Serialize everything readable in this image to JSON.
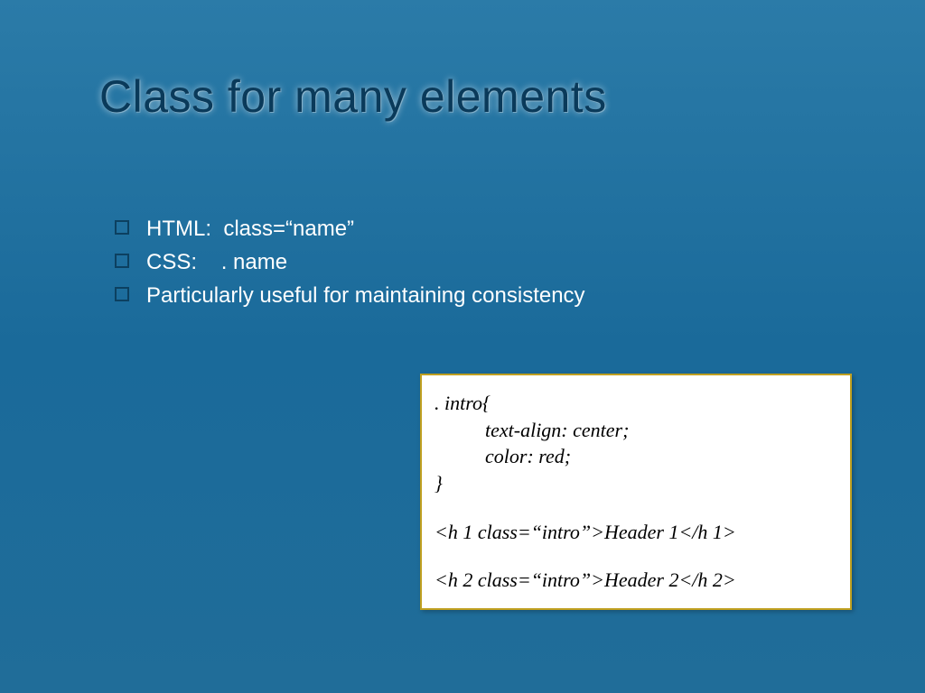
{
  "title": "Class for many elements",
  "bullets": [
    "HTML:  class=“name”",
    "CSS:    . name",
    "Particularly useful for maintaining consistency"
  ],
  "code": {
    "line1": ". intro{",
    "line2": "text-align: center;",
    "line3": "color: red;",
    "line4": "}",
    "line5": "<h 1 class=“intro”>Header 1</h 1>",
    "line6": "<h 2 class=“intro”>Header 2</h 2>"
  }
}
